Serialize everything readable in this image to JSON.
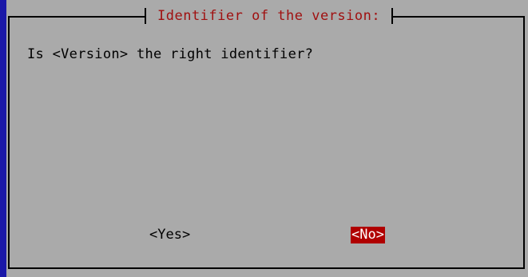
{
  "dialog": {
    "title": "Identifier of the version:",
    "question": "Is <Version> the right identifier?",
    "buttons": {
      "yes_label": "<Yes>",
      "no_label": "<No>",
      "selected": "no"
    }
  },
  "colors": {
    "background_outer": "#1a18a8",
    "dialog_background": "#aaaaaa",
    "title_text": "#a01010",
    "selected_button_background": "#b00000",
    "selected_button_text": "#ffffff"
  }
}
